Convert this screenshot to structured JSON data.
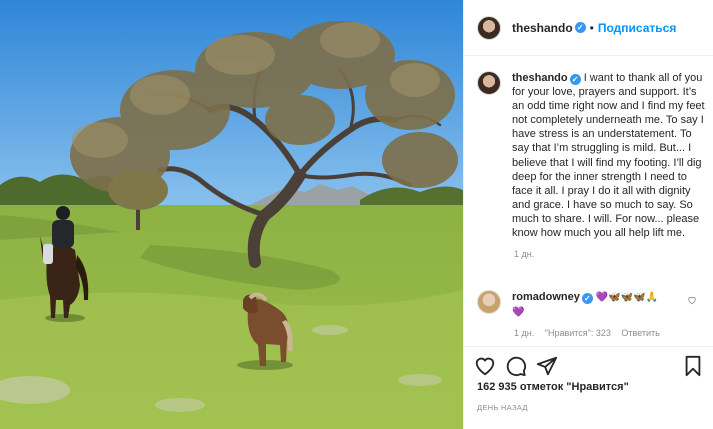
{
  "post": {
    "username": "theshando",
    "follow_label": "Подписаться",
    "caption": "I want to thank all of you for your love, prayers and support. It’s an odd time right now and I find my feet not completely underneath me. To say I have stress is an understatement. To say that I’m struggling is mild. But... I believe that I will find my footing. I’ll dig deep for the inner strength I need to face it all. I pray I do it all with dignity and grace. I have so much to say. So much to share. I will. For now... please know how much you all help lift me.",
    "caption_age": "1 дн.",
    "likes": "162 935 отметок \"Нравится\"",
    "date": "ДЕНЬ НАЗАД"
  },
  "comment": {
    "username": "romadowney",
    "emojis": "💜🦋🦋🦋🙏",
    "emojis_line2": "💜",
    "age": "1 дн.",
    "likes": "\"Нравится\": 323",
    "reply_label": "Ответить"
  },
  "icons": {
    "like": "heart-icon",
    "comment": "comment-icon",
    "share": "paper-plane-icon",
    "save": "bookmark-icon",
    "verified": "verified-badge-icon"
  },
  "colors": {
    "link_blue": "#0095f6",
    "verified_blue": "#3897f0",
    "text": "#262626",
    "muted": "#8e8e8e"
  }
}
